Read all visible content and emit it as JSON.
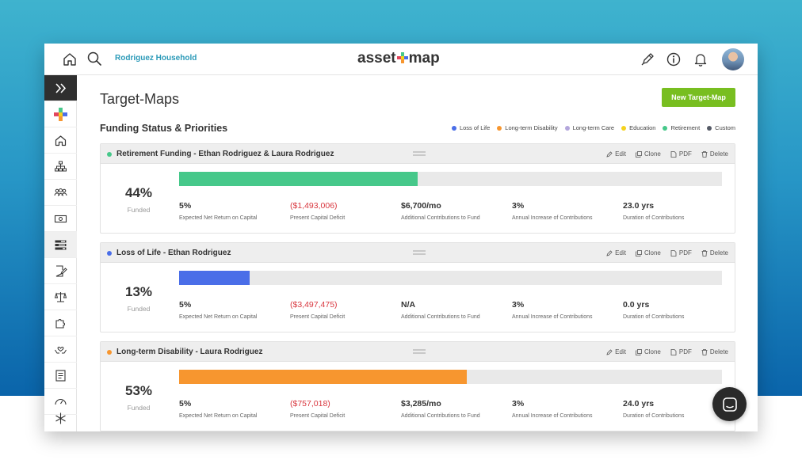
{
  "header": {
    "household": "Rodriguez Household",
    "logo_left": "asset",
    "logo_right": "map"
  },
  "page": {
    "title": "Target-Maps",
    "new_button": "New Target-Map",
    "section_title": "Funding Status & Priorities"
  },
  "legend": [
    {
      "label": "Loss of Life",
      "color": "#4a6ee8"
    },
    {
      "label": "Long-term Disability",
      "color": "#f7962f"
    },
    {
      "label": "Long-term Care",
      "color": "#b3a6dc"
    },
    {
      "label": "Education",
      "color": "#f5d21d"
    },
    {
      "label": "Retirement",
      "color": "#46c88a"
    },
    {
      "label": "Custom",
      "color": "#555a66"
    }
  ],
  "actions": {
    "edit": "Edit",
    "clone": "Clone",
    "pdf": "PDF",
    "delete": "Delete"
  },
  "funded_label": "Funded",
  "cards": [
    {
      "title": "Retirement Funding - Ethan Rodriguez & Laura Rodriguez",
      "color": "#46c88a",
      "percent": "44%",
      "fill": 0.44,
      "metrics": [
        {
          "value": "5%",
          "label": "Expected Net Return on Capital",
          "negative": false
        },
        {
          "value": "($1,493,006)",
          "label": "Present Capital Deficit",
          "negative": true
        },
        {
          "value": "$6,700/mo",
          "label": "Additional Contributions to Fund",
          "negative": false
        },
        {
          "value": "3%",
          "label": "Annual Increase of Contributions",
          "negative": false
        },
        {
          "value": "23.0 yrs",
          "label": "Duration of Contributions",
          "negative": false
        }
      ]
    },
    {
      "title": "Loss of Life - Ethan Rodriguez",
      "color": "#4a6ee8",
      "percent": "13%",
      "fill": 0.13,
      "metrics": [
        {
          "value": "5%",
          "label": "Expected Net Return on Capital",
          "negative": false
        },
        {
          "value": "($3,497,475)",
          "label": "Present Capital Deficit",
          "negative": true
        },
        {
          "value": "N/A",
          "label": "Additional Contributions to Fund",
          "negative": false
        },
        {
          "value": "3%",
          "label": "Annual Increase of Contributions",
          "negative": false
        },
        {
          "value": "0.0 yrs",
          "label": "Duration of Contributions",
          "negative": false
        }
      ]
    },
    {
      "title": "Long-term Disability - Laura Rodriguez",
      "color": "#f7962f",
      "percent": "53%",
      "fill": 0.53,
      "metrics": [
        {
          "value": "5%",
          "label": "Expected Net Return on Capital",
          "negative": false
        },
        {
          "value": "($757,018)",
          "label": "Present Capital Deficit",
          "negative": true
        },
        {
          "value": "$3,285/mo",
          "label": "Additional Contributions to Fund",
          "negative": false
        },
        {
          "value": "3%",
          "label": "Annual Increase of Contributions",
          "negative": false
        },
        {
          "value": "24.0 yrs",
          "label": "Duration of Contributions",
          "negative": false
        }
      ]
    }
  ]
}
